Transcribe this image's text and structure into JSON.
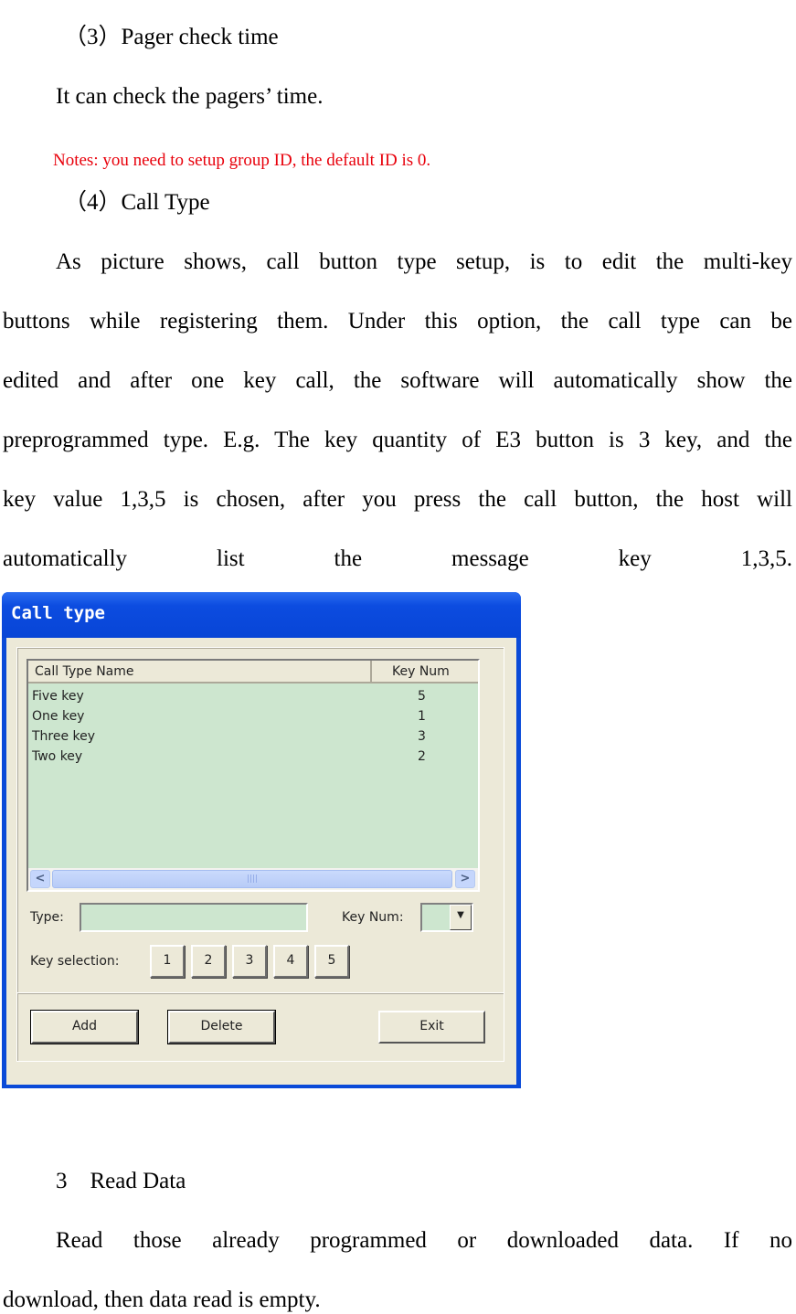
{
  "doc": {
    "heading3": "（3）Pager check time",
    "para3": "It can check the pagers’ time.",
    "note": "Notes: you need to setup group ID, the default ID is 0.",
    "heading4": "（4）Call Type",
    "para4_lines": [
      "As picture shows, call button type setup, is to edit the multi-key",
      "buttons while registering them. Under this option, the call type can be",
      "edited and after one key call, the software will automatically show the",
      "preprogrammed type. E.g. The key quantity of E3 button is 3 key, and the",
      "key value 1,3,5 is chosen, after you press the call button, the host will",
      "automatically list the message key 1,3,5."
    ],
    "section3_heading": "3　Read Data",
    "section3_lines": [
      "Read those already programmed or downloaded data. If no",
      "download, then data read is empty."
    ],
    "note_color": "#e8000b"
  },
  "window": {
    "title": "Call type",
    "list": {
      "columns": [
        "Call Type Name",
        "Key Num"
      ],
      "rows": [
        {
          "name": "Five  key",
          "key_num": "5"
        },
        {
          "name": "One key",
          "key_num": "1"
        },
        {
          "name": "Three  key",
          "key_num": "3"
        },
        {
          "name": "Two key",
          "key_num": "2"
        }
      ],
      "scroll_left": "<",
      "scroll_right": ">",
      "thumb_grip": "||||"
    },
    "type_label": "Type:",
    "type_value": "",
    "key_num_label": "Key Num:",
    "key_num_value": "",
    "dropdown_arrow": "▼",
    "key_selection_label": "Key selection:",
    "key_buttons": [
      "1",
      "2",
      "3",
      "4",
      "5"
    ],
    "buttons": {
      "add": "Add",
      "delete": "Delete",
      "exit": "Exit"
    }
  }
}
